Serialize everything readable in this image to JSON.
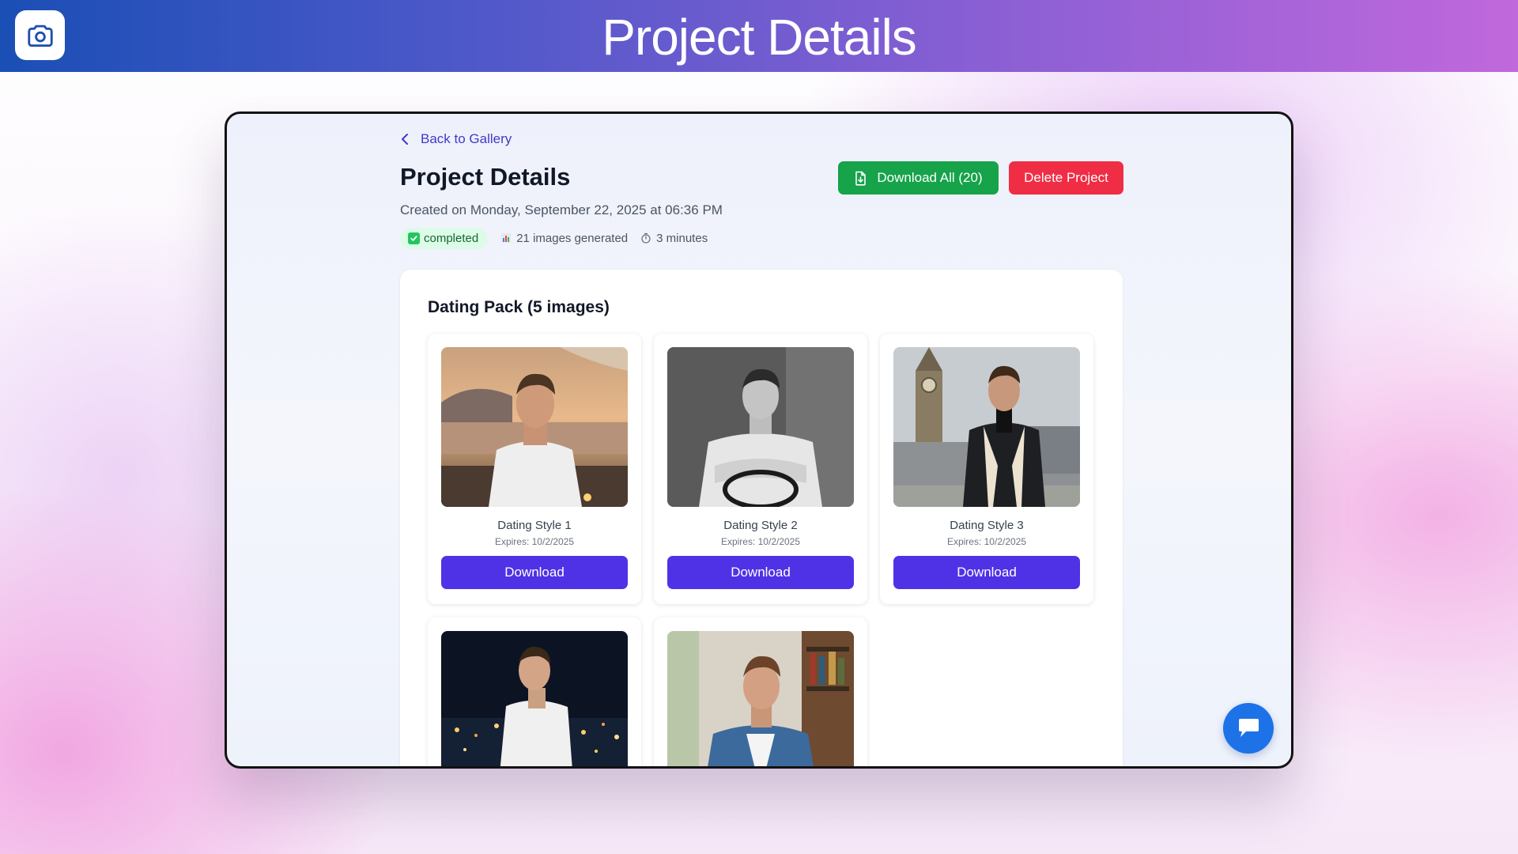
{
  "banner": {
    "title": "Project Details"
  },
  "back_link": {
    "label": "Back to Gallery"
  },
  "page": {
    "title": "Project Details",
    "created": "Created on Monday, September 22, 2025 at 06:36 PM",
    "status": "completed",
    "images_generated": "21 images generated",
    "duration": "3 minutes"
  },
  "actions": {
    "download_all": "Download All (20)",
    "delete": "Delete Project"
  },
  "pack": {
    "title": "Dating Pack (5 images)",
    "cards": [
      {
        "name": "Dating Style 1",
        "expires": "Expires: 10/2/2025",
        "button": "Download"
      },
      {
        "name": "Dating Style 2",
        "expires": "Expires: 10/2/2025",
        "button": "Download"
      },
      {
        "name": "Dating Style 3",
        "expires": "Expires: 10/2/2025",
        "button": "Download"
      }
    ]
  },
  "colors": {
    "accent": "#4f32e6",
    "success": "#16a34a",
    "danger": "#ef2d45",
    "link": "#4338ca",
    "chat": "#1d72e8"
  },
  "icons": {
    "logo": "camera-icon",
    "back": "chevron-left-icon",
    "status": "check-icon",
    "images": "bar-chart-icon",
    "duration": "stopwatch-icon",
    "download_all": "file-download-icon",
    "chat": "chat-bubble-icon"
  }
}
